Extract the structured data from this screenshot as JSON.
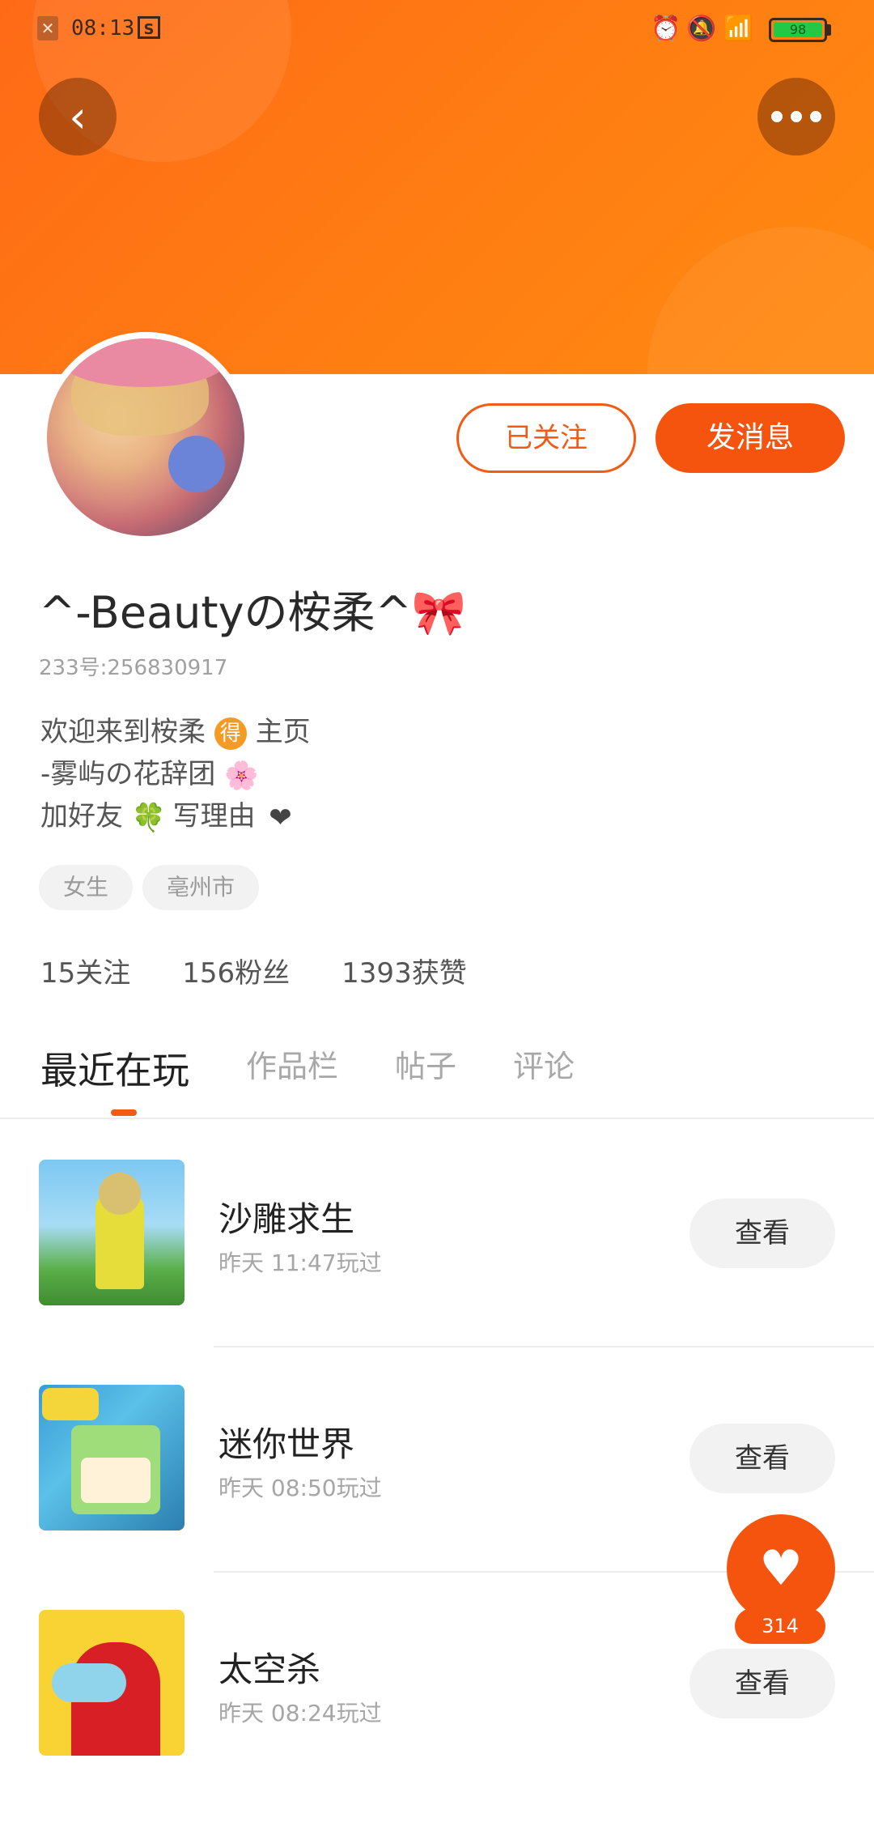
{
  "status_bar": {
    "time": "08:13",
    "battery": "98",
    "icons": [
      "close-notification-icon",
      "screenshot-icon",
      "alarm-icon",
      "mute-icon",
      "wifi-icon",
      "battery-icon"
    ]
  },
  "header": {
    "back_icon": "‹",
    "more_icon": "more-icon"
  },
  "profile": {
    "username": "^-Beautyの桉柔^",
    "username_emoji": "🎀",
    "uid": "233号:256830917",
    "bio_line1_a": "欢迎来到桉柔",
    "bio_line1_emoji": "得",
    "bio_line1_b": "主页",
    "bio_line2_a": "-雾屿の花辞团",
    "bio_line2_emoji": "🌸",
    "bio_line3_a": "加好友",
    "bio_line3_emoji": "🍀",
    "bio_line3_b": "写理由",
    "bio_line3_emoji2": "❤",
    "tags": [
      "女生",
      "亳州市"
    ],
    "stats": {
      "following": "15关注",
      "followers": "156粉丝",
      "likes": "1393获赞"
    }
  },
  "actions": {
    "follow_label": "已关注",
    "message_label": "发消息"
  },
  "tabs": [
    {
      "label": "最近在玩",
      "active": true
    },
    {
      "label": "作品栏",
      "active": false
    },
    {
      "label": "帖子",
      "active": false
    },
    {
      "label": "评论",
      "active": false
    }
  ],
  "games": [
    {
      "title": "沙雕求生",
      "time": "昨天 11:47玩过",
      "button": "查看"
    },
    {
      "title": "迷你世界",
      "time": "昨天 08:50玩过",
      "button": "查看"
    },
    {
      "title": "太空杀",
      "time": "昨天 08:24玩过",
      "button": "查看"
    }
  ],
  "like_fab": {
    "count": "314",
    "icon": "heart-icon"
  },
  "colors": {
    "accent": "#f5540e",
    "header_gradient_start": "#ff6a16",
    "header_gradient_end": "#ff8a10"
  }
}
